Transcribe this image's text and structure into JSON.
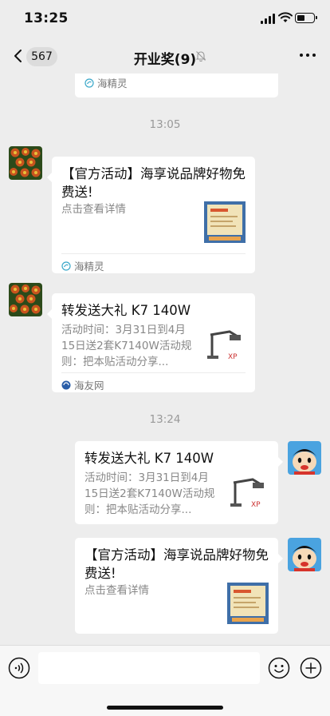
{
  "status": {
    "time": "13:25"
  },
  "nav": {
    "unread_count": "567",
    "title": "开业奖(9)"
  },
  "messages": [
    {
      "type": "source_stub",
      "source": "海精灵"
    },
    {
      "type": "time",
      "text": "13:05"
    },
    {
      "type": "card",
      "from": "other",
      "title": "【官方活动】海享说品牌好物免费送!",
      "desc": "点击查看详情",
      "source": "海精灵",
      "thumb": "poster"
    },
    {
      "type": "card",
      "from": "other",
      "title": "转发送大礼 K7 140W",
      "desc": "活动时间：3月31日到4月15日送2套K7140W活动规则：把本贴活动分享...",
      "source": "海友网",
      "thumb": "lamp"
    },
    {
      "type": "time",
      "text": "13:24"
    },
    {
      "type": "card",
      "from": "self",
      "title": "转发送大礼 K7 140W",
      "desc": "活动时间：3月31日到4月15日送2套K7140W活动规则：把本贴活动分享...",
      "thumb": "lamp"
    },
    {
      "type": "card",
      "from": "self",
      "title": "【官方活动】海享说品牌好物免费送!",
      "desc": "点击查看详情",
      "thumb": "poster"
    }
  ],
  "input": {
    "placeholder": ""
  },
  "icons": [
    "back-arrow-icon",
    "mute-bell-icon",
    "more-dots-icon",
    "voice-icon",
    "emoji-icon",
    "plus-icon"
  ]
}
